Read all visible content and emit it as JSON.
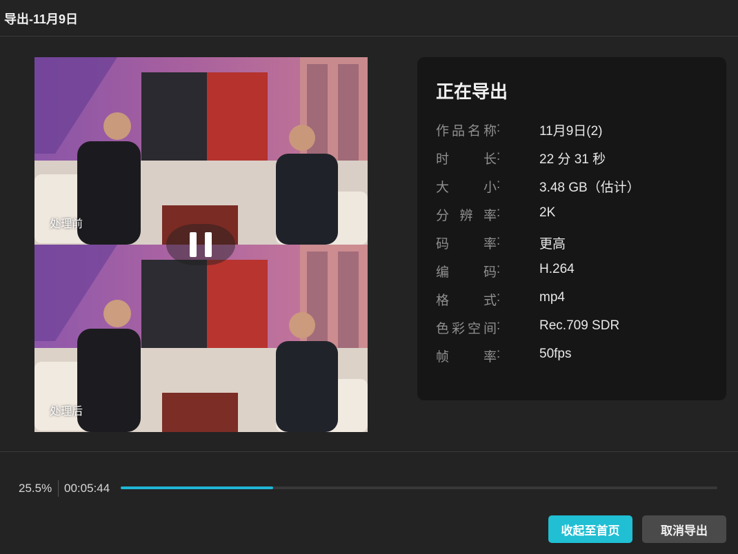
{
  "window": {
    "title": "导出-11月9日"
  },
  "preview": {
    "label_before": "处理前",
    "label_after": "处理后",
    "pause_icon": "pause-icon"
  },
  "info": {
    "heading": "正在导出",
    "rows": [
      {
        "key": "作品名称",
        "value": "11月9日(2)"
      },
      {
        "key": "时长",
        "value": "22 分 31 秒"
      },
      {
        "key": "大小",
        "value": "3.48 GB（估计）"
      },
      {
        "key": "分辨率",
        "value": "2K"
      },
      {
        "key": "码率",
        "value": "更高"
      },
      {
        "key": "编码",
        "value": "H.264"
      },
      {
        "key": "格式",
        "value": "mp4"
      },
      {
        "key": "色彩空间",
        "value": "Rec.709 SDR"
      },
      {
        "key": "帧率",
        "value": "50fps"
      }
    ],
    "colon": ":"
  },
  "progress": {
    "percent_text": "25.5%",
    "elapsed": "00:05:44",
    "fraction": 0.255,
    "accent": "#1fb6d4"
  },
  "buttons": {
    "collapse": "收起至首页",
    "cancel": "取消导出"
  }
}
